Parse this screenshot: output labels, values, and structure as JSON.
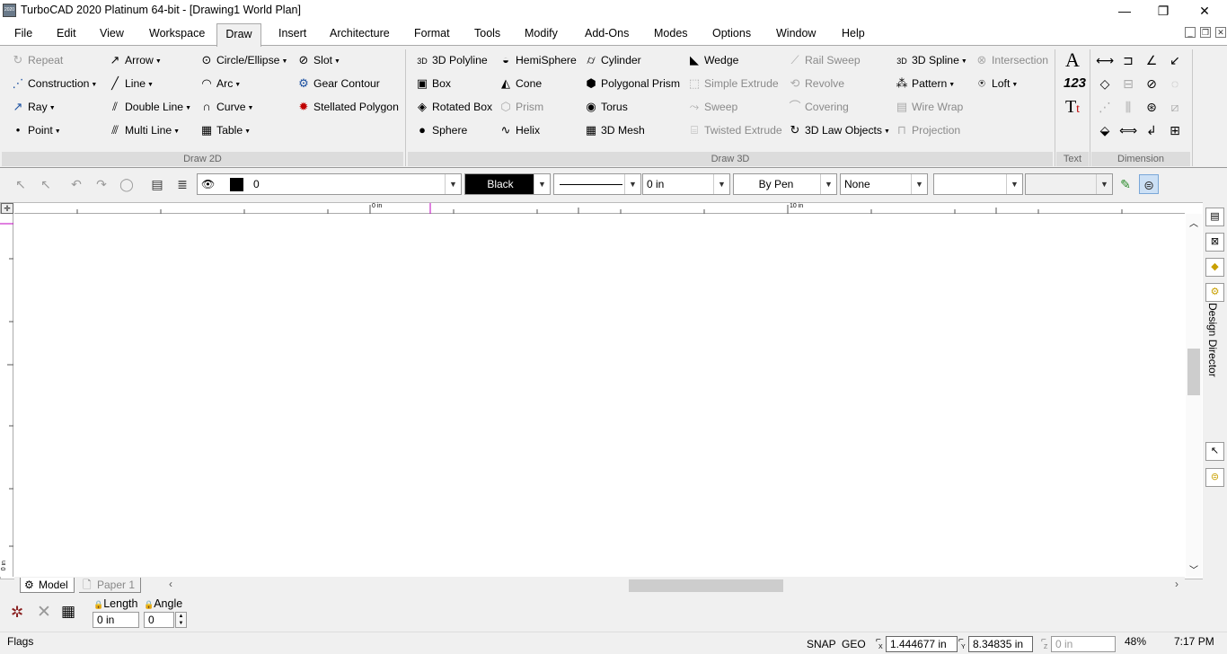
{
  "window": {
    "title": "TurboCAD 2020 Platinum 64-bit - [Drawing1 World Plan]",
    "minimize": "—",
    "restore": "❐",
    "close": "✕",
    "app_icon_text": "2020"
  },
  "menu": {
    "items": [
      "File",
      "Edit",
      "View",
      "Workspace",
      "Draw",
      "Insert",
      "Architecture",
      "Format",
      "Tools",
      "Modify",
      "Add-Ons",
      "Modes",
      "Options",
      "Window",
      "Help"
    ],
    "active": "Draw"
  },
  "ribbon": {
    "groups": {
      "draw2d": "Draw 2D",
      "draw3d": "Draw 3D",
      "text": "Text",
      "dimension": "Dimension"
    },
    "draw2d": {
      "repeat": "Repeat",
      "construction": "Construction",
      "ray": "Ray",
      "point": "Point",
      "arrow": "Arrow",
      "line": "Line",
      "double_line": "Double Line",
      "multi_line": "Multi Line",
      "circle_ellipse": "Circle/Ellipse",
      "arc": "Arc",
      "curve": "Curve",
      "table": "Table",
      "slot": "Slot",
      "gear_contour": "Gear Contour",
      "stellated_polygon": "Stellated Polygon"
    },
    "draw3d": {
      "polyline3d": "3D Polyline",
      "box": "Box",
      "rotated_box": "Rotated Box",
      "sphere": "Sphere",
      "hemisphere": "HemiSphere",
      "cone": "Cone",
      "prism": "Prism",
      "helix": "Helix",
      "cylinder": "Cylinder",
      "polygonal_prism": "Polygonal Prism",
      "torus": "Torus",
      "mesh3d": "3D Mesh",
      "wedge": "Wedge",
      "simple_extrude": "Simple Extrude",
      "sweep": "Sweep",
      "twisted_extrude": "Twisted Extrude",
      "rail_sweep": "Rail Sweep",
      "revolve": "Revolve",
      "covering": "Covering",
      "law_objects": "3D Law Objects",
      "spline3d": "3D Spline",
      "pattern": "Pattern",
      "wire_wrap": "Wire Wrap",
      "projection": "Projection",
      "intersection": "Intersection",
      "loft": "Loft"
    }
  },
  "toolbar": {
    "layer_value": "0",
    "color_value": "Black",
    "width_value": "0 in",
    "pen_value": "By Pen",
    "fill_value": "None"
  },
  "ruler": {
    "mark0": "0 in",
    "mark10": "10 in",
    "vmark": "0 in"
  },
  "tabs": {
    "model": "Model",
    "paper1": "Paper 1"
  },
  "inspector": {
    "length_label": "Length",
    "angle_label": "Angle",
    "length_value": "0 in",
    "angle_value": "0"
  },
  "status": {
    "flags": "Flags",
    "snap": "SNAP",
    "geo": "GEO",
    "x": "1.444677 in",
    "y": "8.34835 in",
    "z": "0 in",
    "zoom": "48%",
    "time": "7:17 PM",
    "x_label": "X",
    "y_label": "Y",
    "z_label": "Z"
  },
  "dock": {
    "design_director": "Design Director"
  },
  "colors": {
    "accent": "#1a4fa0",
    "black_swatch": "#000000",
    "ruler_cursor": "#c000c0"
  }
}
